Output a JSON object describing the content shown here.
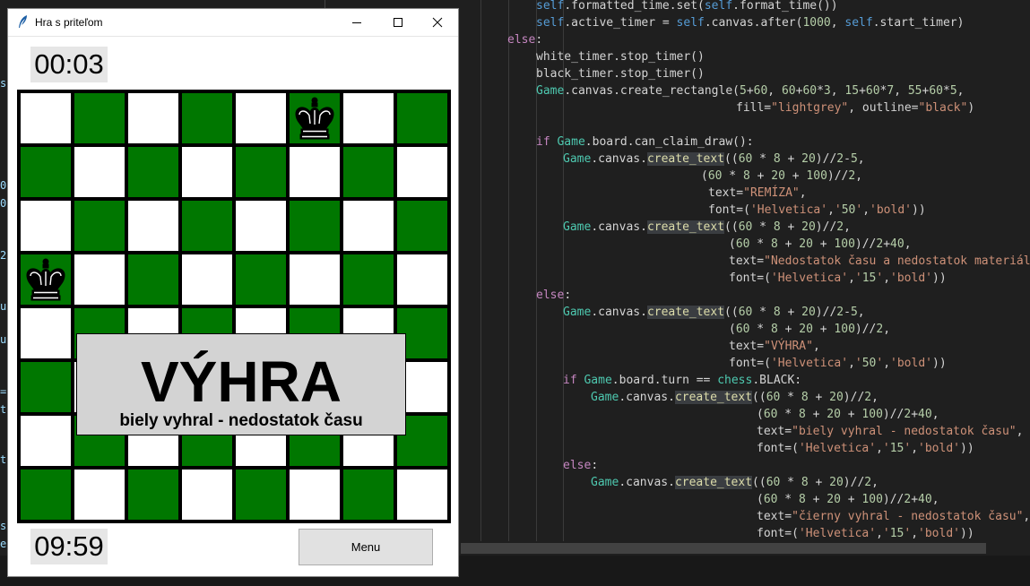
{
  "window": {
    "title": "Hra s priteľom",
    "minimize_label": "—",
    "maximize_label": "□",
    "close_label": "✕"
  },
  "timers": {
    "top": "00:03",
    "bottom": "09:59"
  },
  "board": {
    "rows": 8,
    "cols": 8,
    "light_color": "#ffffff",
    "dark_color": "#007700",
    "pieces": [
      {
        "piece": "black-king",
        "row": 0,
        "col": 5
      },
      {
        "piece": "black-king",
        "row": 3,
        "col": 0
      }
    ]
  },
  "result": {
    "title": "VÝHRA",
    "subtitle": "biely vyhral - nedostatok času"
  },
  "menu_button": {
    "label": "Menu"
  },
  "editor": {
    "left_strip": [
      "s",
      "0",
      "0",
      "2",
      "u",
      "u",
      "=",
      "t",
      "t",
      "s",
      "e"
    ],
    "lines": [
      {
        "text": "self.formatted_time.set(self.format_time())",
        "indent": 32
      },
      {
        "text": "self.active_timer = self.canvas.after(1000, self.start_timer)",
        "indent": 32
      },
      {
        "text": "else:",
        "indent": 0
      },
      {
        "text": "white_timer.stop_timer()",
        "indent": 32
      },
      {
        "text": "black_timer.stop_timer()",
        "indent": 32
      },
      {
        "text": "Game.canvas.create_rectangle(5+60, 60+60*3, 15+60*7, 55+60*5,",
        "indent": 32
      },
      {
        "text": "fill=\"lightgrey\", outline=\"black\")",
        "indent": 255
      },
      {
        "text": "",
        "indent": 0
      },
      {
        "text": "if Game.board.can_claim_draw():",
        "indent": 32
      },
      {
        "text": "Game.canvas.create_text((60 * 8 + 20)//2-5,",
        "indent": 62
      },
      {
        "text": "(60 * 8 + 20 + 100)//2,",
        "indent": 216
      },
      {
        "text": "text=\"REMÍZA\",",
        "indent": 224
      },
      {
        "text": "font=('Helvetica','50','bold'))",
        "indent": 224
      },
      {
        "text": "Game.canvas.create_text((60 * 8 + 20)//2,",
        "indent": 62
      },
      {
        "text": "(60 * 8 + 20 + 100)//2+40,",
        "indent": 247
      },
      {
        "text": "text=\"Nedostatok času a nedostatok materiálo",
        "indent": 247
      },
      {
        "text": "font=('Helvetica','15','bold'))",
        "indent": 247
      },
      {
        "text": "else:",
        "indent": 32
      },
      {
        "text": "Game.canvas.create_text((60 * 8 + 20)//2-5,",
        "indent": 62
      },
      {
        "text": "(60 * 8 + 20 + 100)//2,",
        "indent": 247
      },
      {
        "text": "text=\"VÝHRA\",",
        "indent": 247
      },
      {
        "text": "font=('Helvetica','50','bold'))",
        "indent": 247
      },
      {
        "text": "if Game.board.turn == chess.BLACK:",
        "indent": 62
      },
      {
        "text": "Game.canvas.create_text((60 * 8 + 20)//2,",
        "indent": 93
      },
      {
        "text": "(60 * 8 + 20 + 100)//2+40,",
        "indent": 278
      },
      {
        "text": "text=\"biely vyhral - nedostatok času\",",
        "indent": 278
      },
      {
        "text": "font=('Helvetica','15','bold'))",
        "indent": 278
      },
      {
        "text": "else:",
        "indent": 62
      },
      {
        "text": "Game.canvas.create_text((60 * 8 + 20)//2,",
        "indent": 93
      },
      {
        "text": "(60 * 8 + 20 + 100)//2+40,",
        "indent": 278
      },
      {
        "text": "text=\"čierny vyhral - nedostatok času\",",
        "indent": 278
      },
      {
        "text": "font=('Helvetica','15','bold'))",
        "indent": 278
      }
    ]
  }
}
